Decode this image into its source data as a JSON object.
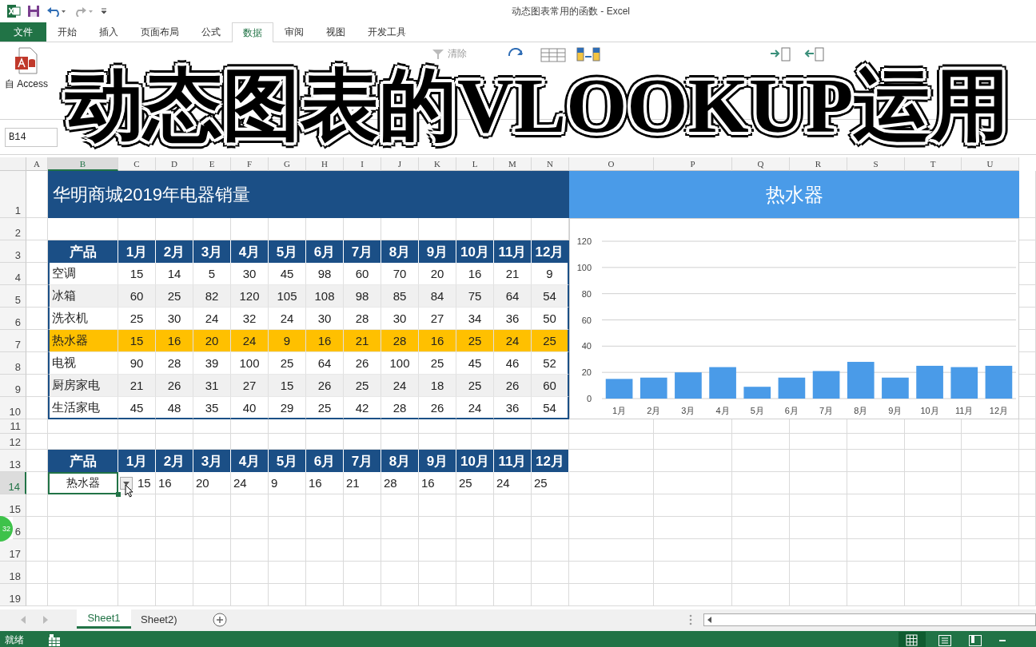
{
  "window": {
    "title": "动态图表常用的函数 - Excel"
  },
  "file_tab": "文件",
  "ribbon_tabs": [
    {
      "label": "开始",
      "selected": false
    },
    {
      "label": "插入",
      "selected": false
    },
    {
      "label": "页面布局",
      "selected": false
    },
    {
      "label": "公式",
      "selected": false
    },
    {
      "label": "数据",
      "selected": true
    },
    {
      "label": "审阅",
      "selected": false
    },
    {
      "label": "视图",
      "selected": false
    },
    {
      "label": "开发工具",
      "selected": false
    }
  ],
  "ribbon": {
    "access_label": "自 Access",
    "clear_label": "清除"
  },
  "overlay_title": "动态图表的VLOOKUP运用",
  "name_box": "B14",
  "columns": [
    {
      "label": "A",
      "selected": false
    },
    {
      "label": "B",
      "selected": true
    },
    {
      "label": "C",
      "selected": false
    },
    {
      "label": "D",
      "selected": false
    },
    {
      "label": "E",
      "selected": false
    },
    {
      "label": "F",
      "selected": false
    },
    {
      "label": "G",
      "selected": false
    },
    {
      "label": "H",
      "selected": false
    },
    {
      "label": "I",
      "selected": false
    },
    {
      "label": "J",
      "selected": false
    },
    {
      "label": "K",
      "selected": false
    },
    {
      "label": "L",
      "selected": false
    },
    {
      "label": "M",
      "selected": false
    },
    {
      "label": "N",
      "selected": false
    },
    {
      "label": "O",
      "selected": false
    },
    {
      "label": "P",
      "selected": false
    },
    {
      "label": "Q",
      "selected": false
    },
    {
      "label": "R",
      "selected": false
    },
    {
      "label": "S",
      "selected": false
    },
    {
      "label": "T",
      "selected": false
    },
    {
      "label": "U",
      "selected": false
    }
  ],
  "rows": [
    {
      "label": "1",
      "selected": false
    },
    {
      "label": "2",
      "selected": false
    },
    {
      "label": "3",
      "selected": false
    },
    {
      "label": "4",
      "selected": false
    },
    {
      "label": "5",
      "selected": false
    },
    {
      "label": "6",
      "selected": false
    },
    {
      "label": "7",
      "selected": false
    },
    {
      "label": "8",
      "selected": false
    },
    {
      "label": "9",
      "selected": false
    },
    {
      "label": "10",
      "selected": false
    },
    {
      "label": "11",
      "selected": false
    },
    {
      "label": "12",
      "selected": false
    },
    {
      "label": "13",
      "selected": false
    },
    {
      "label": "14",
      "selected": true
    },
    {
      "label": "15",
      "selected": false
    },
    {
      "label": "6",
      "selected": false
    },
    {
      "label": "17",
      "selected": false
    },
    {
      "label": "18",
      "selected": false
    },
    {
      "label": "19",
      "selected": false
    }
  ],
  "sheet_title": "华明商城2019年电器销量",
  "sales_table": {
    "header": [
      "产品",
      "1月",
      "2月",
      "3月",
      "4月",
      "5月",
      "6月",
      "7月",
      "8月",
      "9月",
      "10月",
      "11月",
      "12月"
    ],
    "rows": [
      {
        "product": "空调",
        "values": [
          "15",
          "14",
          "5",
          "30",
          "45",
          "98",
          "60",
          "70",
          "20",
          "16",
          "21",
          "9"
        ],
        "highlighted": false
      },
      {
        "product": "冰箱",
        "values": [
          "60",
          "25",
          "82",
          "120",
          "105",
          "108",
          "98",
          "85",
          "84",
          "75",
          "64",
          "54"
        ],
        "highlighted": false
      },
      {
        "product": "洗衣机",
        "values": [
          "25",
          "30",
          "24",
          "32",
          "24",
          "30",
          "28",
          "30",
          "27",
          "34",
          "36",
          "50"
        ],
        "highlighted": false
      },
      {
        "product": "热水器",
        "values": [
          "15",
          "16",
          "20",
          "24",
          "9",
          "16",
          "21",
          "28",
          "16",
          "25",
          "24",
          "25"
        ],
        "highlighted": true
      },
      {
        "product": "电视",
        "values": [
          "90",
          "28",
          "39",
          "100",
          "25",
          "64",
          "26",
          "100",
          "25",
          "45",
          "46",
          "52"
        ],
        "highlighted": false
      },
      {
        "product": "厨房家电",
        "values": [
          "21",
          "26",
          "31",
          "27",
          "15",
          "26",
          "25",
          "24",
          "18",
          "25",
          "26",
          "60"
        ],
        "highlighted": false
      },
      {
        "product": "生活家电",
        "values": [
          "45",
          "48",
          "35",
          "40",
          "29",
          "25",
          "42",
          "28",
          "26",
          "24",
          "36",
          "54"
        ],
        "highlighted": false
      }
    ]
  },
  "chart_header": "热水器",
  "chart_data": {
    "type": "bar",
    "grid": true,
    "categories": [
      "1月",
      "2月",
      "3月",
      "4月",
      "5月",
      "6月",
      "7月",
      "8月",
      "9月",
      "10月",
      "11月",
      "12月"
    ],
    "series": [
      {
        "color": "#4a9be8",
        "values": [
          15,
          16,
          20,
          24,
          9,
          16,
          21,
          28,
          16,
          25,
          24,
          25
        ]
      }
    ],
    "ylim": [
      0,
      120
    ],
    "yticks": [
      0,
      20,
      40,
      60,
      80,
      100,
      120
    ]
  },
  "lookup_table": {
    "header": [
      "产品",
      "1月",
      "2月",
      "3月",
      "4月",
      "5月",
      "6月",
      "7月",
      "8月",
      "9月",
      "10月",
      "11月",
      "12月"
    ],
    "product": "热水器",
    "values": [
      "15",
      "16",
      "20",
      "24",
      "9",
      "16",
      "21",
      "28",
      "16",
      "25",
      "24",
      "25"
    ]
  },
  "sheet_tabs": [
    {
      "label": "Sheet1",
      "selected": true
    },
    {
      "label": "Sheet2)",
      "selected": false
    }
  ],
  "status_bar": {
    "text": "就绪"
  },
  "recorder_badge": "32"
}
